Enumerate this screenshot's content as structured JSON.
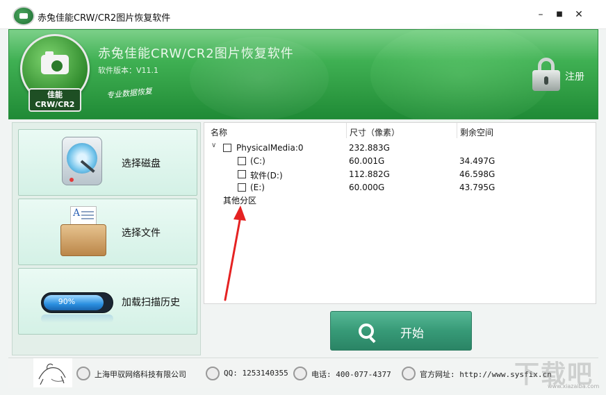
{
  "window": {
    "title": "赤兔佳能CRW/CR2图片恢复软件",
    "controls": {
      "minimize": "–",
      "maximize": "■",
      "close": "✕"
    }
  },
  "header": {
    "app_name": "赤兔佳能CRW/CR2图片恢复软件",
    "version": "软件版本：V11.1",
    "slogan": "专业数据恢复",
    "logo_line1": "佳能",
    "logo_line2": "CRW/CR2",
    "register_label": "注册"
  },
  "sidebar": {
    "items": [
      {
        "label": "选择磁盘",
        "icon": "disk-icon"
      },
      {
        "label": "选择文件",
        "icon": "folder-icon"
      },
      {
        "label": "加载扫描历史",
        "icon": "progress-icon",
        "progress_text": "90%",
        "progress": 0.9
      }
    ]
  },
  "table": {
    "columns": [
      "名称",
      "尺寸（像素）",
      "剩余空间"
    ],
    "rows": [
      {
        "name": "PhysicalMedia:0",
        "size": "232.883G",
        "free": ""
      },
      {
        "name": "(C:)",
        "size": "60.001G",
        "free": "34.497G"
      },
      {
        "name": "软件(D:)",
        "size": "112.882G",
        "free": "46.598G"
      },
      {
        "name": "(E:)",
        "size": "60.000G",
        "free": "43.795G"
      }
    ],
    "other_partition": "其他分区"
  },
  "start_button": {
    "label": "开始"
  },
  "footer": {
    "company": "上海甲驭网络科技有限公司",
    "qq": "QQ: 1253140355",
    "phone": "电话: 400-077-4377",
    "website": "官方网址: http://www.sysfix.cn"
  },
  "watermark": {
    "text": "下载吧",
    "url": "www.xiazaiba.com"
  },
  "colors": {
    "header_green": "#3fb053",
    "start_green": "#379a77",
    "panel_bg": "#e3efe9",
    "annotation_red": "#e52222"
  }
}
